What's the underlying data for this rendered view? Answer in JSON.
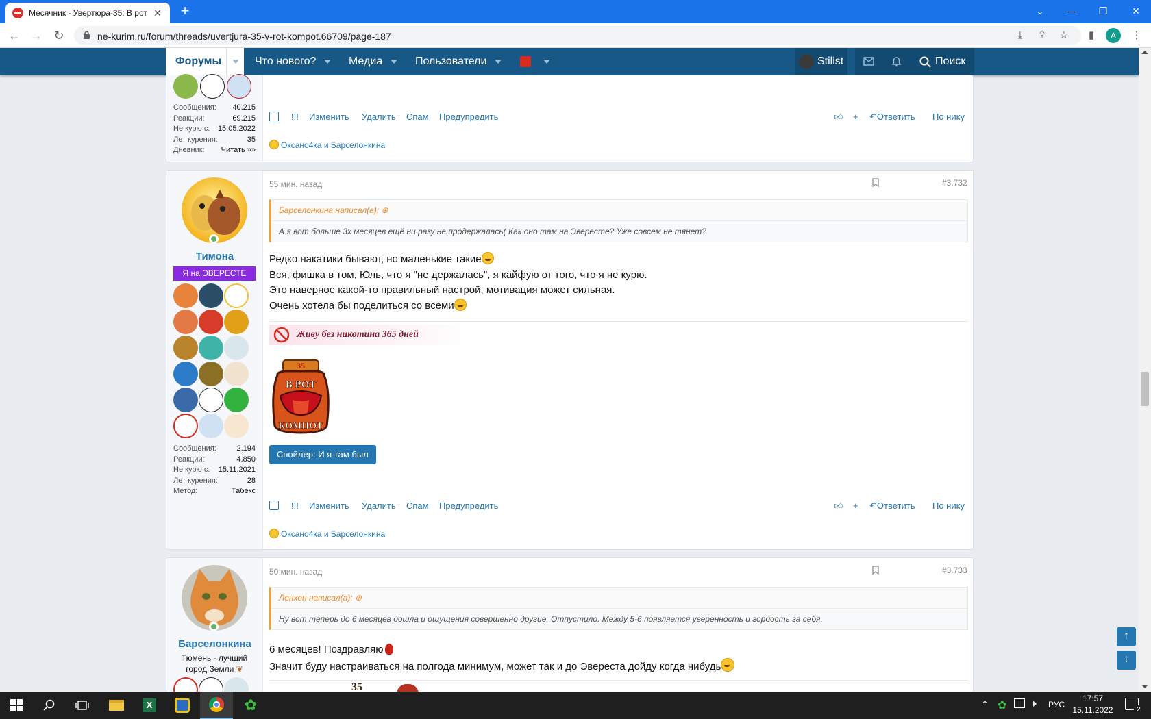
{
  "browser": {
    "tab_title": "Месячник - Увертюра-35: В рот",
    "url": "ne-kurim.ru/forum/threads/uvertjura-35-v-rot-kompot.66709/page-187",
    "profile_initial": "A"
  },
  "nav": {
    "forums": "Форумы",
    "whats_new": "Что нового?",
    "media": "Медиа",
    "users": "Пользователи",
    "username": "Stilist",
    "search": "Поиск"
  },
  "colors": {
    "nav_bg": "#185886",
    "accent": "#2577b1",
    "quote_accent": "#f59c3c",
    "banner": "#8a2be2"
  },
  "actions": {
    "report": "!!!",
    "edit": "Изменить",
    "delete": "Удалить",
    "spam": "Спам",
    "warn": "Предупредить",
    "reply": "Ответить",
    "by_nick": "По нику"
  },
  "post0": {
    "stats": [
      {
        "label": "Сообщения:",
        "value": "40.215"
      },
      {
        "label": "Реакции:",
        "value": "69.215"
      },
      {
        "label": "Не курю с:",
        "value": "15.05.2022"
      },
      {
        "label": "Лет курения:",
        "value": "35"
      },
      {
        "label": "Дневник:",
        "value": "Читать »»"
      }
    ],
    "reactions": "Оксано4ка и Барселонкина"
  },
  "post1": {
    "time": "55 мин. назад",
    "number": "#3.732",
    "username": "Тимона",
    "banner": "Я на ЭВЕРЕСТЕ",
    "quote_author": "Барселонкина написал(а):",
    "quote_text": "А я вот больше 3х месяцев ещё ни разу не продержалась( Как оно там на Эвересте? Уже совсем не тянет?",
    "lines": [
      "Редко накатики бывают, но маленькие такие",
      "Вся, фишка в том, Юль, что я \"не держалась\", я кайфую от того, что я не курю.",
      "Это наверное какой-то правильный настрой, мотивация может сильная.",
      "Очень хотела бы поделиться со всеми"
    ],
    "signature": "Живу без никотина 365 дней",
    "jar_top": "35",
    "jar_text1": "В РОТ",
    "jar_text2": "КОМПОТ",
    "spoiler": "Спойлер: И я там был",
    "stats": [
      {
        "label": "Сообщения:",
        "value": "2.194"
      },
      {
        "label": "Реакции:",
        "value": "4.850"
      },
      {
        "label": "Не курю с:",
        "value": "15.11.2021"
      },
      {
        "label": "Лет курения:",
        "value": "28"
      },
      {
        "label": "Метод:",
        "value": "Табекс"
      }
    ],
    "reactions": "Оксано4ка и Барселонкина"
  },
  "post2": {
    "time": "50 мин. назад",
    "number": "#3.733",
    "username": "Барселонкина",
    "user_title": "Тюмень - лучший город Земли",
    "quote_author": "Ленхен написал(а):",
    "quote_text": "Ну вот теперь до 6 месяцев дошла и ощущения совершенно другие. Отпустило. Между 5-6 появляется уверенность и гордость за себя.",
    "lines": [
      "6 месяцев! Поздравляю",
      "Значит буду настраиваться на полгода минимум, может так и до Эвереста дойду когда нибудь"
    ],
    "sig_peek": "35"
  },
  "taskbar": {
    "lang": "РУС",
    "time": "17:57",
    "date": "15.11.2022",
    "notif_count": "2"
  }
}
